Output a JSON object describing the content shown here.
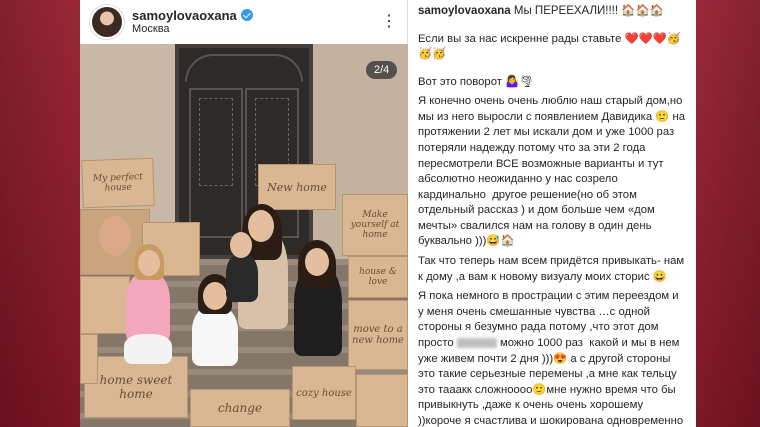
{
  "post": {
    "username": "samoylovaoxana",
    "location": "Москва",
    "slide_counter": "2/4",
    "more_icon": "more-vertical-icon"
  },
  "photo": {
    "boxes": [
      "My perfect house",
      "New home",
      "Make yourself at home",
      "home sweet home",
      "home",
      "move to a new home",
      "home sweet home",
      "cozy house",
      "change",
      "house & love"
    ]
  },
  "caption": {
    "username": "samoylovaoxana",
    "title": "Мы ПЕРЕЕХАЛИ!!!! 🏠🏠🏠",
    "p1": "Если вы за нас искренне рады ставьте ❤️❤️❤️🥳 🥳🥳",
    "p2": "Вот это поворот 🤷‍♀️🌪",
    "p3_a": "Я конечно очень очень люблю наш старый дом,но мы из него выросли с появлением Давидика 🙂 на протяжении 2 лет мы искали дом и уже 1000 раз потеряли надежду потому что за эти 2 года пересмотрели ВСЕ возможные варианты и тут абсолютно неожиданно у нас созрело кардинально  другое решение(но об этом отдельный рассказ ) и дом больше чем «дом мечты» свалился нам на голову в один день буквально )))😅🏠",
    "p4": "Так что теперь нам всем придётся привыкать- нам к дому ,а вам к новому визуалу моих сторис 😀",
    "p5_a": "Я пока немного в прострации с этим переездом и у меня очень смешанные чувства …с одной стороны я безумно рада потому ,что этот дом просто",
    "p5_b": "можно 1000 раз  какой и мы в нем уже живем почти 2 дня )))😍 а с другой стороны это такие серьезные перемены ,а мне как тельцу это тааакк сложноооо🙂мне нужно время что бы привыкнуть ,даже к очень очень хорошему ))короче я счастлива и шокирована одновременно 😄🥳"
  },
  "colors": {
    "accent": "#3897f0",
    "background": "#b52236",
    "text": "#262626"
  }
}
